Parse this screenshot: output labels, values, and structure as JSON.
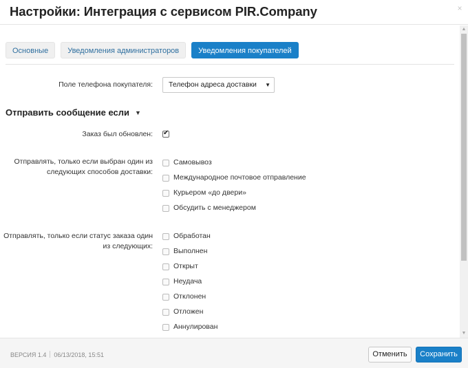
{
  "window": {
    "title": "Настройки: Интеграция с сервисом PIR.Company",
    "close_glyph": "×"
  },
  "tabs": [
    {
      "label": "Основные",
      "active": false
    },
    {
      "label": "Уведомления администраторов",
      "active": false
    },
    {
      "label": "Уведомления покупателей",
      "active": true
    }
  ],
  "phone_field": {
    "label": "Поле телефона покупателя:",
    "value": "Телефон адреса доставки"
  },
  "section": {
    "title": "Отправить сообщение если",
    "icon": "caret-down-icon"
  },
  "order_updated": {
    "label": "Заказ был обновлен:",
    "checked": true
  },
  "delivery_methods": {
    "label": "Отправлять, только если выбран один из следующих способов доставки:",
    "options": [
      {
        "label": "Самовывоз",
        "checked": false
      },
      {
        "label": "Международное почтовое отправление",
        "checked": false
      },
      {
        "label": "Курьером «до двери»",
        "checked": false
      },
      {
        "label": "Обсудить с менеджером",
        "checked": false
      }
    ]
  },
  "order_statuses": {
    "label": "Отправлять, только если статус заказа один из следующих:",
    "options": [
      {
        "label": "Обработан",
        "checked": false
      },
      {
        "label": "Выполнен",
        "checked": false
      },
      {
        "label": "Открыт",
        "checked": false
      },
      {
        "label": "Неудача",
        "checked": false
      },
      {
        "label": "Отклонен",
        "checked": false
      },
      {
        "label": "Отложен",
        "checked": false
      },
      {
        "label": "Аннулирован",
        "checked": false
      }
    ]
  },
  "footer": {
    "version": "ВЕРСИЯ 1.4",
    "date": "06/13/2018, 15:51",
    "cancel_label": "Отменить",
    "save_label": "Сохранить"
  },
  "colors": {
    "accent": "#1a80c8",
    "tab_text": "#2f6f9f"
  }
}
